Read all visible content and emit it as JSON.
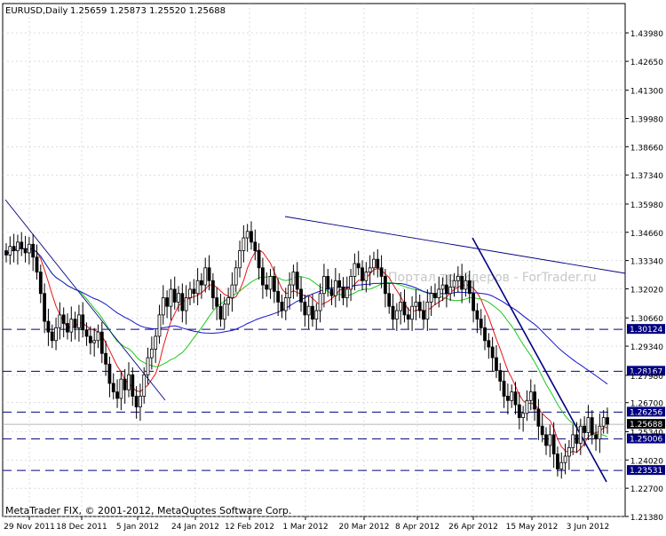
{
  "header": {
    "symbol_timeframe": "EURUSD,Daily",
    "ohlc": "1.25659 1.25873 1.25520 1.25688"
  },
  "watermark": "Портал трейдеров - ForTrader.ru",
  "footer": {
    "copyright": "MetaTrader FIX, © 2001-2012, MetaQuotes Software Corp."
  },
  "colors": {
    "background": "#ffffff",
    "grid": "#c8c8c8",
    "candle": "#000000",
    "ma_fast": "#e8141a",
    "ma_mid": "#1ec81e",
    "ma_slow": "#1414c8",
    "trendline": "#000080",
    "hline": "#000080",
    "price_tag_bg": "#000080",
    "price_tag_text": "#ffffff"
  },
  "chart_data": {
    "type": "candlestick",
    "price_axis_ticks": [
      "1.43980",
      "1.42650",
      "1.41300",
      "1.39980",
      "1.38660",
      "1.37340",
      "1.35980",
      "1.34660",
      "1.33340",
      "1.32020",
      "1.30660",
      "1.29340",
      "1.27980",
      "1.26700",
      "1.25340",
      "1.24020",
      "1.22700",
      "1.21380"
    ],
    "price_range": [
      1.2138,
      1.4535
    ],
    "date_axis_labels": [
      "29 Nov 2011",
      "18 Dec 2011",
      "5 Jan 2012",
      "24 Jan 2012",
      "12 Feb 2012",
      "1 Mar 2012",
      "20 Mar 2012",
      "8 Apr 2012",
      "26 Apr 2012",
      "15 May 2012",
      "3 Jun 2012"
    ],
    "horizontal_levels": [
      {
        "price": 1.30124,
        "label": "1.30124"
      },
      {
        "price": 1.28167,
        "label": "1.28167"
      },
      {
        "price": 1.26256,
        "label": "1.26256"
      },
      {
        "price": 1.25006,
        "label": "1.25006"
      },
      {
        "price": 1.23531,
        "label": "1.23531"
      }
    ],
    "current_price": {
      "price": 1.25688,
      "label": "1.25688"
    },
    "candle_closes": [
      1.336,
      1.34,
      1.338,
      1.342,
      1.339,
      1.337,
      1.341,
      1.335,
      1.328,
      1.318,
      1.305,
      1.3,
      1.296,
      1.302,
      1.308,
      1.304,
      1.3,
      1.306,
      1.302,
      1.308,
      1.301,
      1.298,
      1.295,
      1.296,
      1.3,
      1.29,
      1.285,
      1.276,
      1.272,
      1.269,
      1.278,
      1.273,
      1.28,
      1.27,
      1.265,
      1.27,
      1.28,
      1.288,
      1.292,
      1.298,
      1.308,
      1.316,
      1.312,
      1.32,
      1.314,
      1.318,
      1.31,
      1.316,
      1.32,
      1.318,
      1.324,
      1.322,
      1.33,
      1.324,
      1.316,
      1.312,
      1.306,
      1.313,
      1.316,
      1.322,
      1.33,
      1.338,
      1.344,
      1.347,
      1.342,
      1.338,
      1.33,
      1.322,
      1.32,
      1.326,
      1.319,
      1.314,
      1.31,
      1.316,
      1.322,
      1.328,
      1.32,
      1.314,
      1.308,
      1.312,
      1.306,
      1.31,
      1.318,
      1.326,
      1.32,
      1.317,
      1.324,
      1.321,
      1.316,
      1.32,
      1.326,
      1.332,
      1.33,
      1.324,
      1.328,
      1.33,
      1.334,
      1.33,
      1.326,
      1.318,
      1.312,
      1.306,
      1.31,
      1.314,
      1.308,
      1.306,
      1.312,
      1.314,
      1.31,
      1.306,
      1.314,
      1.318,
      1.316,
      1.32,
      1.322,
      1.318,
      1.321,
      1.324,
      1.326,
      1.32,
      1.324,
      1.318,
      1.31,
      1.306,
      1.302,
      1.296,
      1.293,
      1.288,
      1.282,
      1.277,
      1.27,
      1.268,
      1.272,
      1.266,
      1.26,
      1.262,
      1.268,
      1.272,
      1.264,
      1.256,
      1.252,
      1.247,
      1.252,
      1.243,
      1.236,
      1.239,
      1.242,
      1.246,
      1.252,
      1.248,
      1.256,
      1.253,
      1.26,
      1.252,
      1.25,
      1.256,
      1.26,
      1.2569
    ]
  }
}
